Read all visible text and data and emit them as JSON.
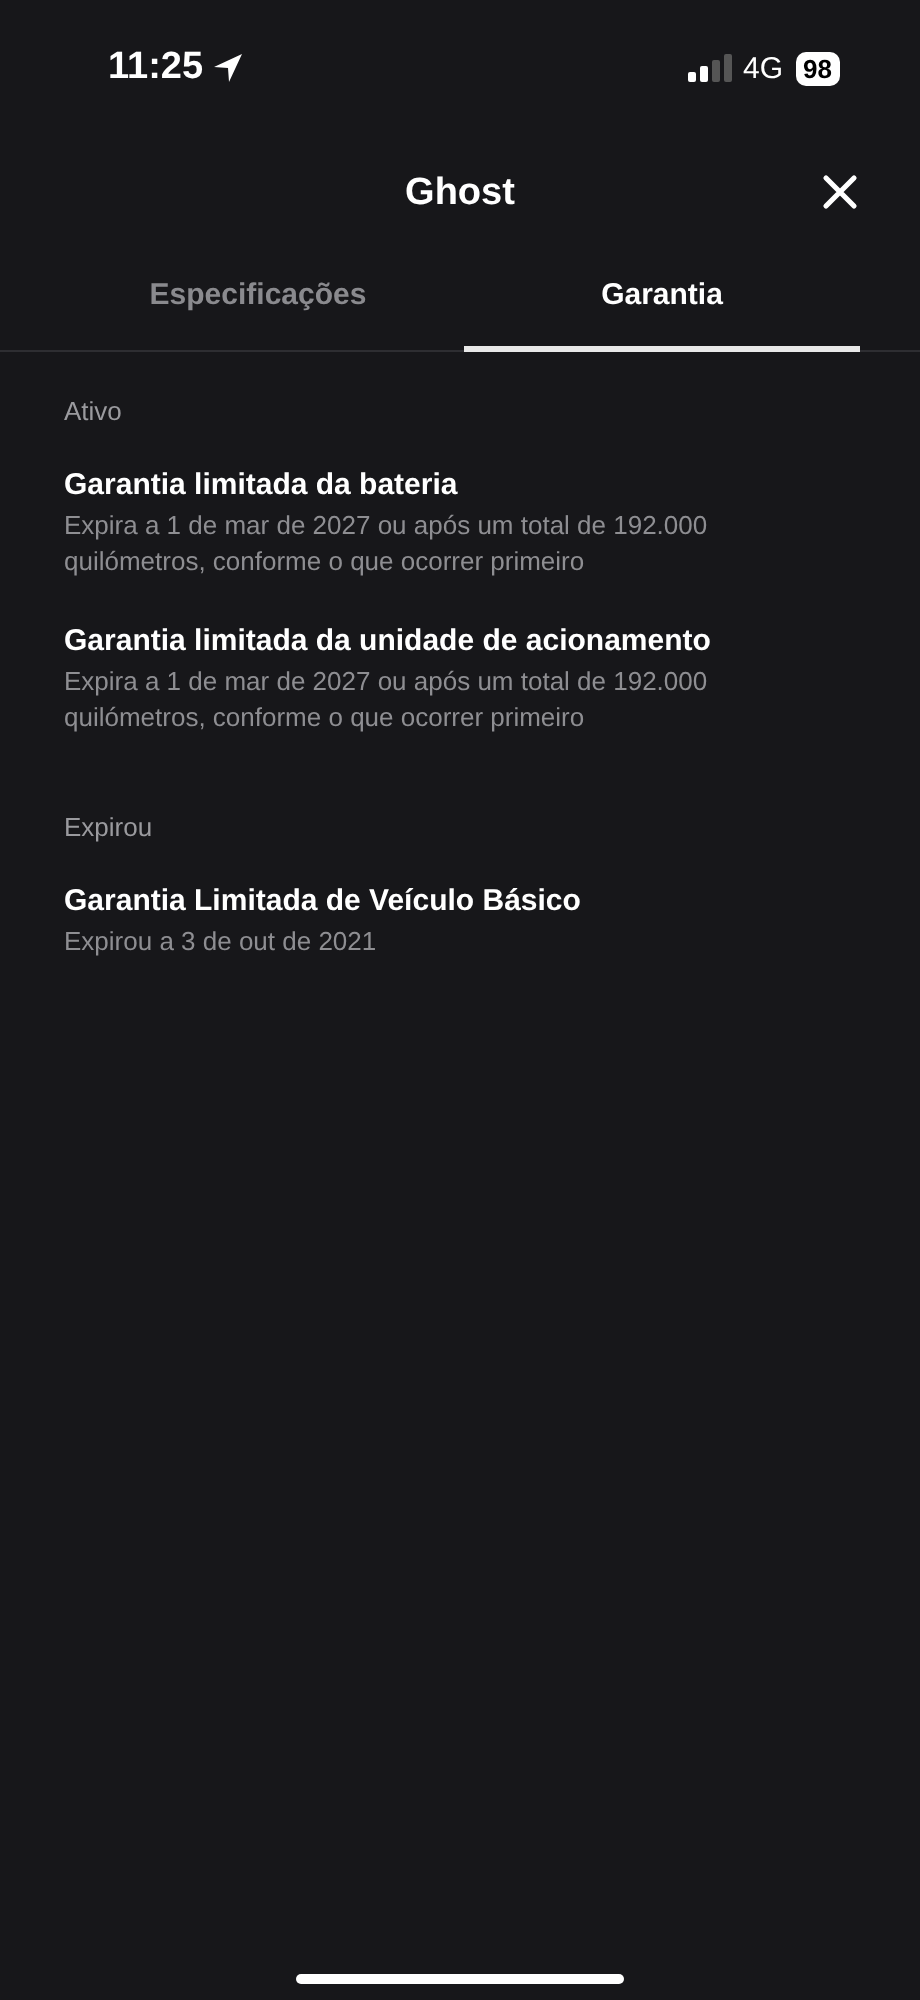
{
  "status_bar": {
    "time": "11:25",
    "network": "4G",
    "battery": "98"
  },
  "header": {
    "title": "Ghost"
  },
  "tabs": [
    {
      "label": "Especificações",
      "selected": false
    },
    {
      "label": "Garantia",
      "selected": true
    }
  ],
  "sections": [
    {
      "heading": "Ativo",
      "items": [
        {
          "title": "Garantia limitada da bateria",
          "detail": "Expira a 1 de mar de 2027 ou após um total de 192.000 quilómetros, conforme o que ocorrer primeiro"
        },
        {
          "title": "Garantia limitada da unidade de acionamento",
          "detail": "Expira a 1 de mar de 2027 ou após um total de 192.000 quilómetros, conforme o que ocorrer primeiro"
        }
      ]
    },
    {
      "heading": "Expirou",
      "items": [
        {
          "title": "Garantia Limitada de Veículo Básico",
          "detail": "Expirou a 3 de out de 2021"
        }
      ]
    }
  ]
}
